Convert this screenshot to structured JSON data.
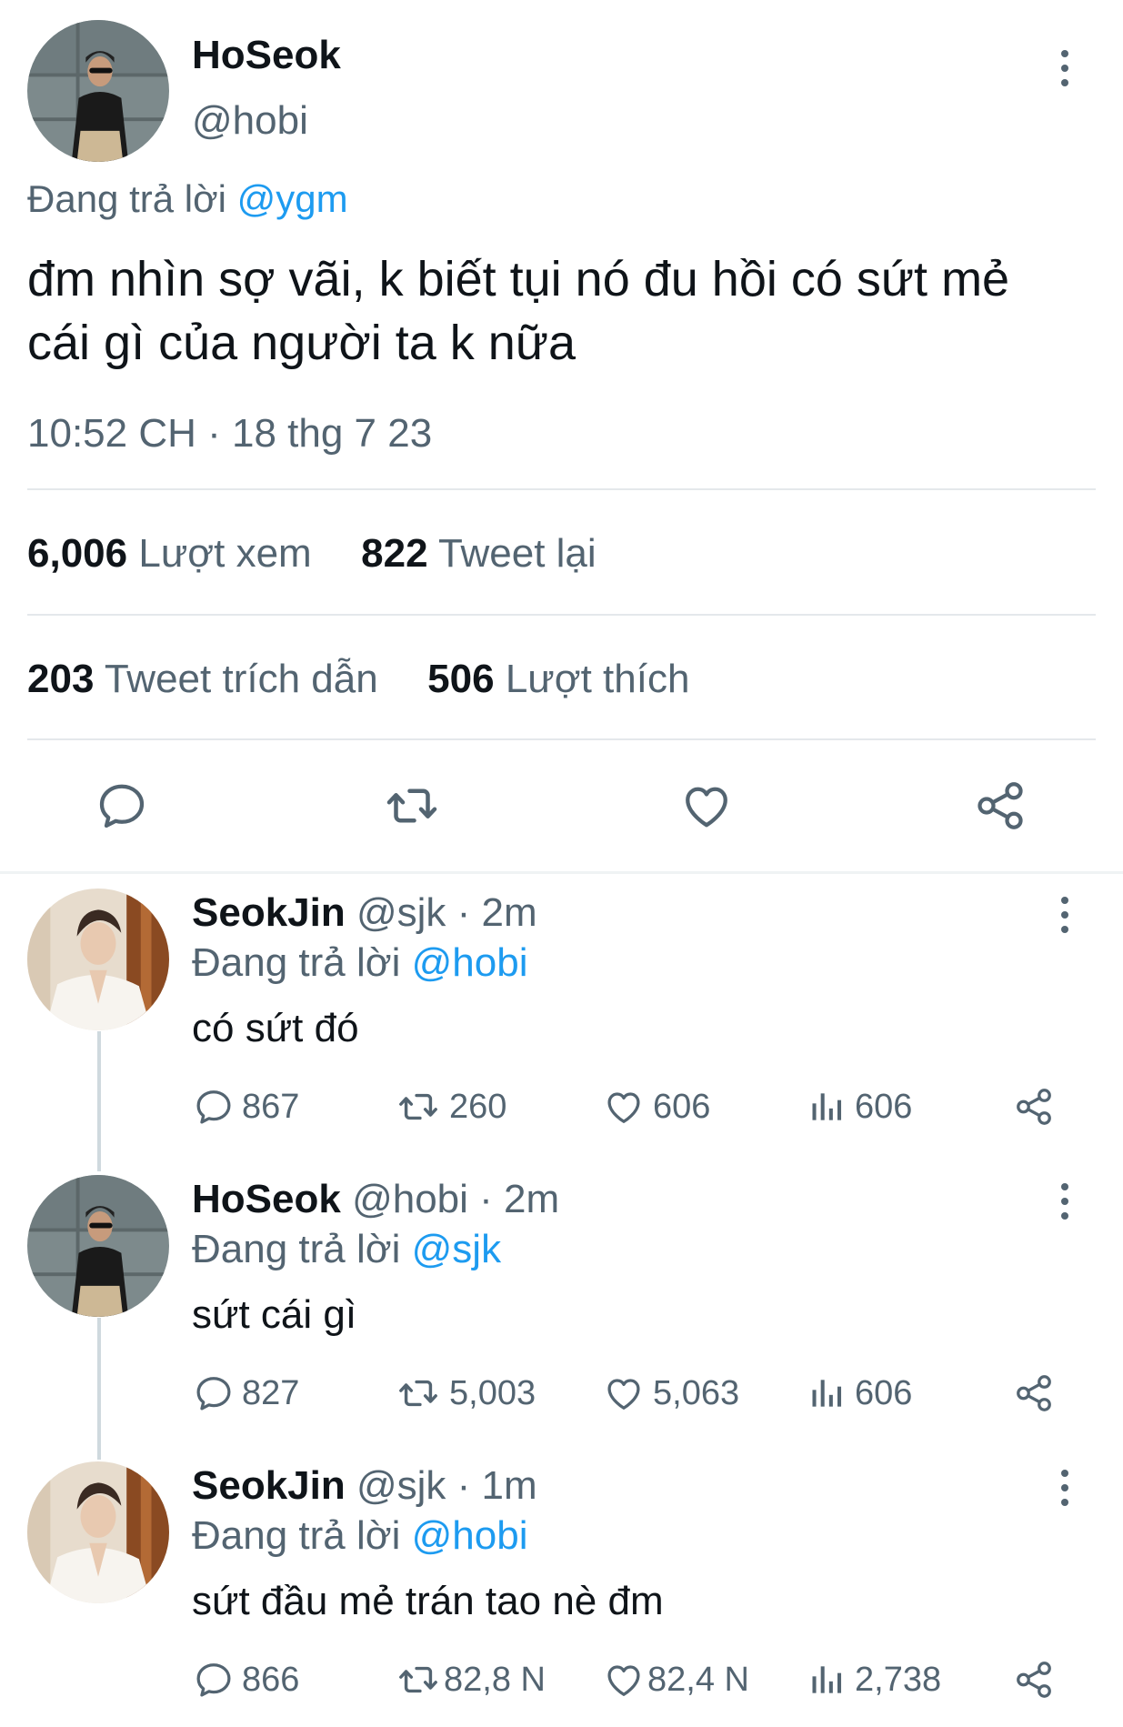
{
  "main_tweet": {
    "display_name": "HoSeok",
    "handle": "@hobi",
    "replying_prefix": "Đang trả lời",
    "replying_to": "@ygm",
    "text_line1": "đm nhìn sợ vãi, k biết tụi nó đu hồi có sứt mẻ",
    "text_line2": "cái gì của người ta k nữa",
    "timestamp": "10:52 CH · 18 thg 7 23",
    "stats": {
      "views_count": "6,006",
      "views_label": "Lượt xem",
      "retweets_count": "822",
      "retweets_label": "Tweet lại",
      "quotes_count": "203",
      "quotes_label": "Tweet trích dẫn",
      "likes_count": "506",
      "likes_label": "Lượt thích"
    },
    "actions": [
      "reply-icon",
      "retweet-icon",
      "like-icon",
      "share-icon"
    ]
  },
  "replies": [
    {
      "display_name": "SeokJin",
      "handle": "@sjk",
      "time": "· 2m",
      "replying_prefix": "Đang trả lời",
      "replying_to": "@hobi",
      "text": "có sứt đó",
      "reply_count": "867",
      "retweet_count": "260",
      "like_count": "606",
      "view_count": "606"
    },
    {
      "display_name": "HoSeok",
      "handle": "@hobi",
      "time": "· 2m",
      "replying_prefix": "Đang trả lời",
      "replying_to": "@sjk",
      "text": "sứt cái gì",
      "reply_count": "827",
      "retweet_count": "5,003",
      "like_count": "5,063",
      "view_count": "606"
    },
    {
      "display_name": "SeokJin",
      "handle": "@sjk",
      "time": "· 1m",
      "replying_prefix": "Đang trả lời",
      "replying_to": "@hobi",
      "text": "sứt đầu mẻ trán tao nè đm",
      "reply_count": "866",
      "retweet_count": "82,8 N",
      "like_count": "82,4 N",
      "view_count": "2,738"
    }
  ],
  "colors": {
    "link": "#1d9bf0",
    "muted": "#536471",
    "text": "#0f1419",
    "divider": "#e4e8eb"
  }
}
